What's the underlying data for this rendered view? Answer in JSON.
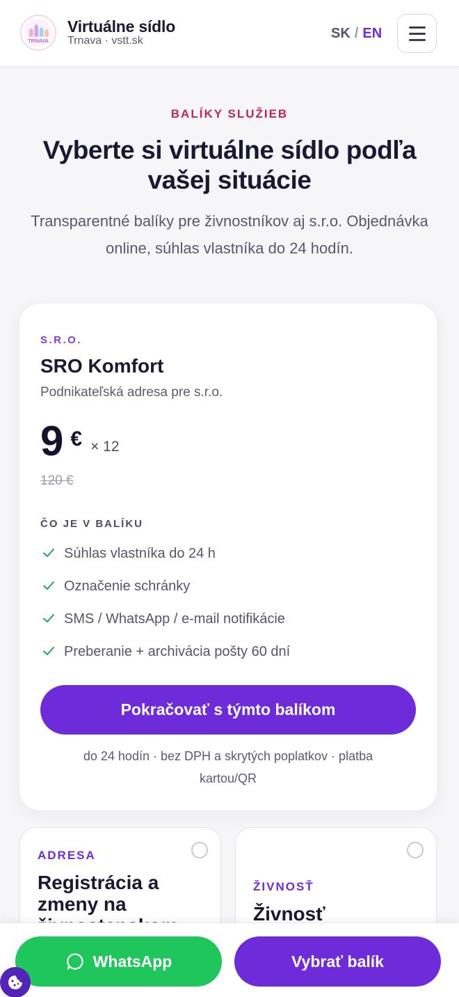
{
  "header": {
    "brand_title": "Virtuálne sídlo",
    "brand_subtitle": "Trnava · vstt.sk",
    "logo_text": "TRNAVA",
    "lang_sk": "SK",
    "lang_separator": "/",
    "lang_en": "EN",
    "menu_icon": "hamburger-icon"
  },
  "hero": {
    "eyebrow": "BALÍKY SLUŽIEB",
    "title": "Vyberte si virtuálne sídlo podľa vašej situácie",
    "subtitle": "Transparentné balíky pre živnostníkov aj s.r.o. Objednávka online, súhlas vlastníka do 24 hodín."
  },
  "main_package": {
    "category": "S.R.O.",
    "name": "SRO Komfort",
    "description": "Podnikateľská adresa pre s.r.o.",
    "price_amount": "9",
    "price_currency": "€",
    "price_multiplier": "× 12",
    "old_price": "120 €",
    "includes_heading": "ČO JE V BALÍKU",
    "features": [
      "Súhlas vlastníka do 24 h",
      "Označenie schránky",
      "SMS / WhatsApp / e-mail notifikácie",
      "Preberanie + archivácia pošty 60 dní"
    ],
    "cta_label": "Pokračovať s týmto balíkom",
    "note": "do 24 hodín · bez DPH a skrytých poplatkov · platba kartou/QR"
  },
  "other_packages": [
    {
      "category": "ADRESA",
      "name": "Registrácia a zmeny na živnostenskom"
    },
    {
      "category": "ŽIVNOSŤ",
      "name": "Živnosť"
    }
  ],
  "bottom_bar": {
    "whatsapp_label": "WhatsApp",
    "choose_label": "Vybrať balík"
  },
  "colors": {
    "accent": "#6d2bd9",
    "eyebrow": "#c0245f",
    "whatsapp": "#1fc65b",
    "check": "#1fa35a"
  }
}
